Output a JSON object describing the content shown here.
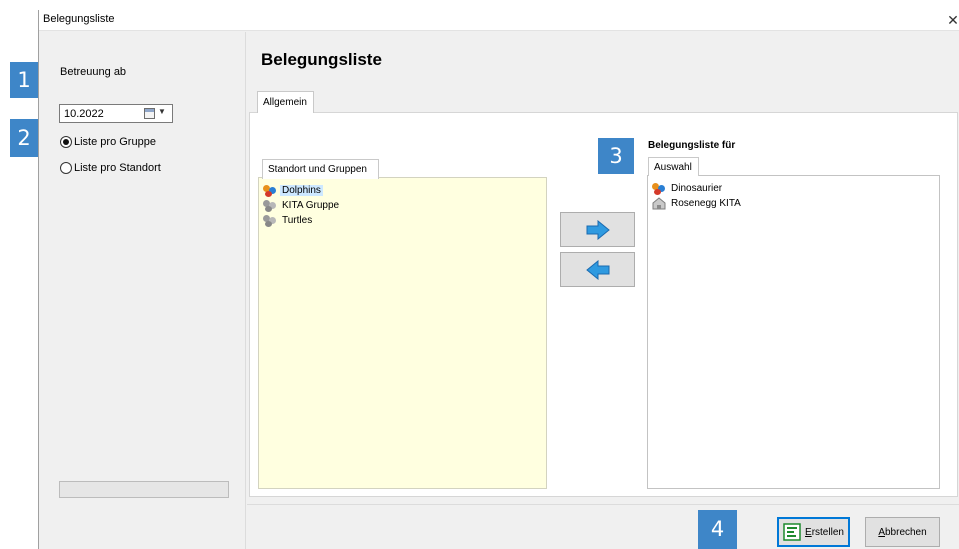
{
  "window": {
    "title": "Belegungsliste",
    "close_glyph": "✕"
  },
  "left": {
    "betreuung_label": "Betreuung ab",
    "date_value": "10.2022",
    "calendar_icon": "calendar-icon",
    "radio_group": [
      {
        "label": "Liste pro Gruppe",
        "checked": true
      },
      {
        "label": "Liste pro Standort",
        "checked": false
      }
    ]
  },
  "main": {
    "heading": "Belegungsliste",
    "tab_label": "Allgemein",
    "left_list": {
      "tab_label": "Standort und Gruppen",
      "items": [
        {
          "label": "Dolphins",
          "icon": "group-color-icon",
          "selected": true
        },
        {
          "label": "KITA Gruppe",
          "icon": "group-gray-icon",
          "selected": false
        },
        {
          "label": "Turtles",
          "icon": "group-gray-icon",
          "selected": false
        }
      ]
    },
    "right_list": {
      "title": "Belegungsliste für",
      "tab_label": "Auswahl",
      "items": [
        {
          "label": "Dinosaurier",
          "icon": "group-color-icon"
        },
        {
          "label": "Rosenegg KITA",
          "icon": "location-house-icon"
        }
      ]
    },
    "buttons": {
      "move_right_icon": "arrow-right-icon",
      "move_left_icon": "arrow-left-icon",
      "create_label": "Erstellen",
      "create_mnemonic": "E",
      "create_rest": "rstellen",
      "cancel_label": "Abbrechen",
      "cancel_mnemonic": "A",
      "cancel_rest": "bbrechen"
    }
  },
  "badges": [
    "1",
    "2",
    "3",
    "4"
  ],
  "colors": {
    "badge": "#3e86c8",
    "list_bg": "#ffffe0",
    "arrow": "#2f9ae0",
    "selection": "#cde8ff"
  }
}
